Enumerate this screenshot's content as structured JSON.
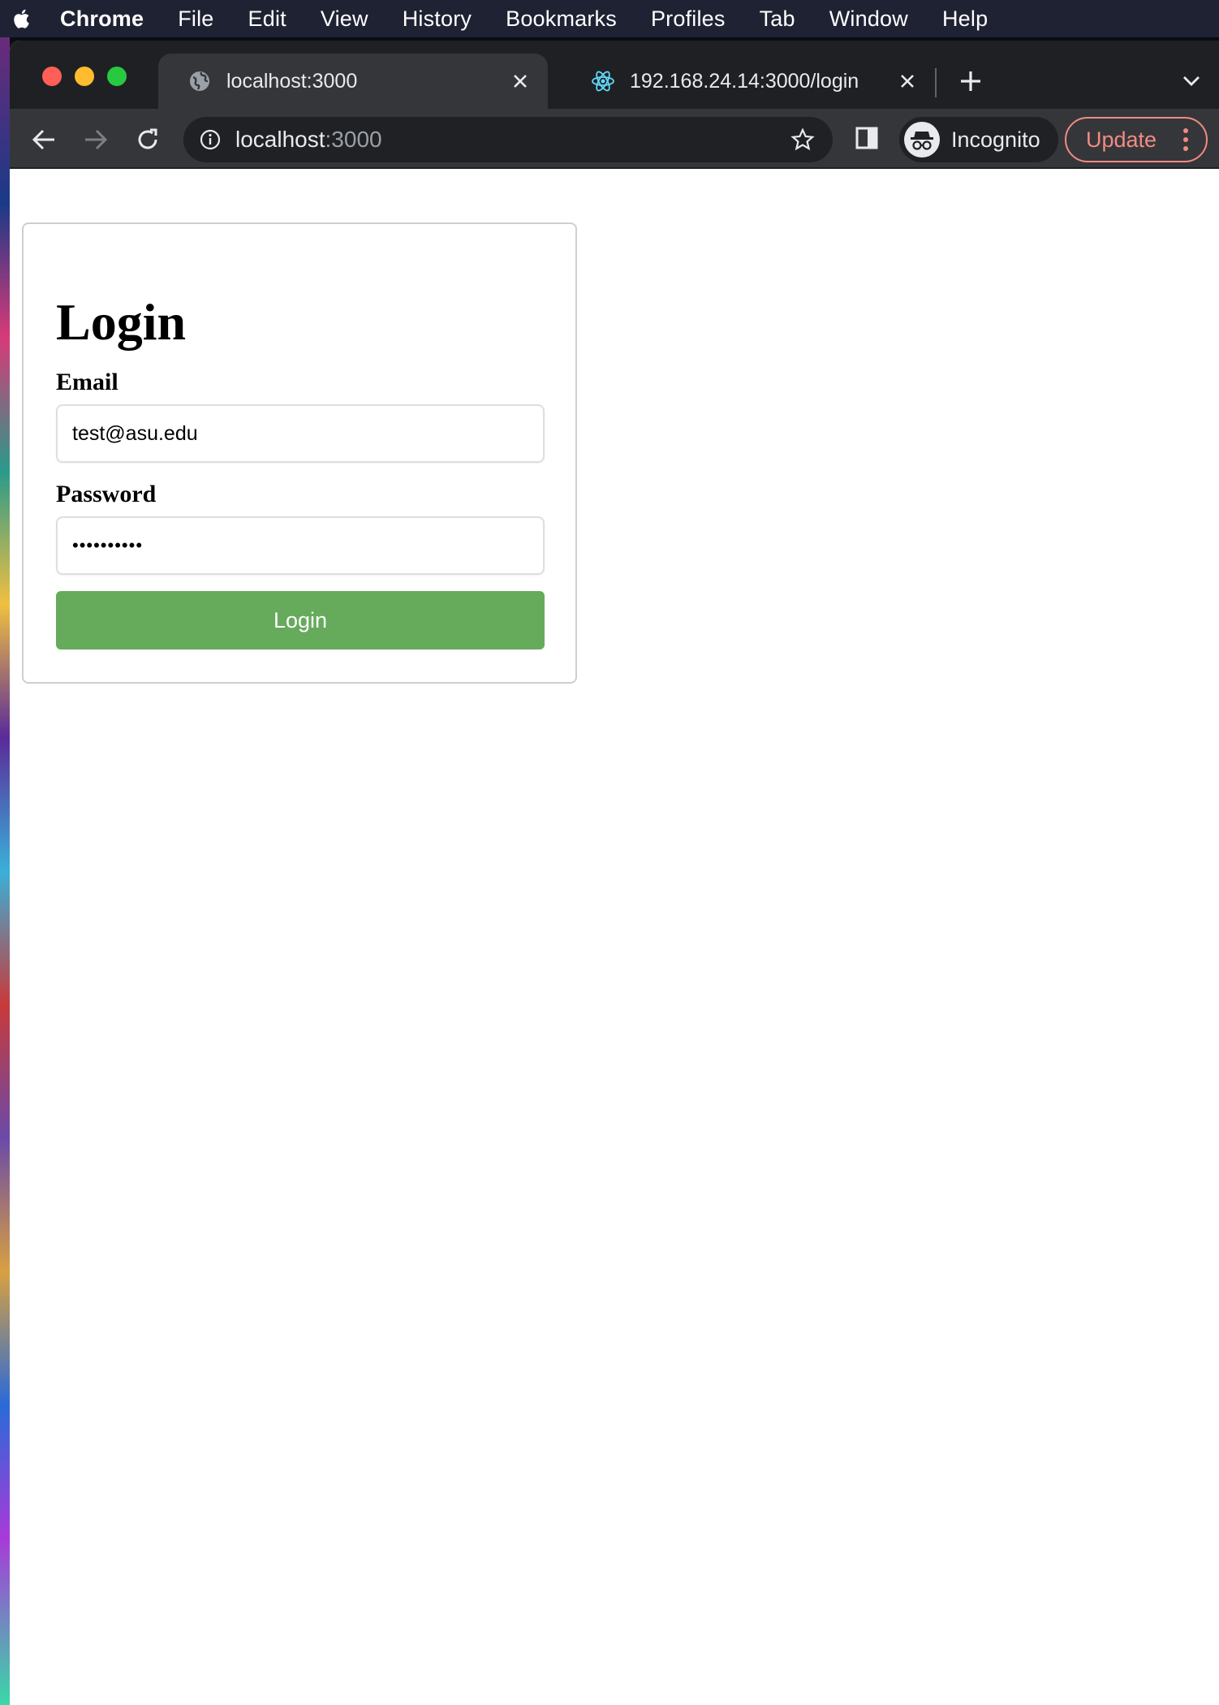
{
  "menubar": {
    "app": "Chrome",
    "items": [
      "File",
      "Edit",
      "View",
      "History",
      "Bookmarks",
      "Profiles",
      "Tab",
      "Window",
      "Help"
    ]
  },
  "tabs": [
    {
      "title": "localhost:3000",
      "icon": "globe-icon",
      "active": true
    },
    {
      "title": "192.168.24.14:3000/login",
      "icon": "react-icon",
      "active": false
    }
  ],
  "omnibox": {
    "host": "localhost",
    "port": ":3000"
  },
  "profile": {
    "label": "Incognito"
  },
  "update_button": {
    "label": "Update"
  },
  "login": {
    "title": "Login",
    "email_label": "Email",
    "email_value": "test@asu.edu",
    "password_label": "Password",
    "password_value": "••••••••••",
    "button_label": "Login"
  },
  "colors": {
    "accent_button": "#66ab5c",
    "update_border": "#f28b82",
    "chrome_dark": "#35363a"
  }
}
